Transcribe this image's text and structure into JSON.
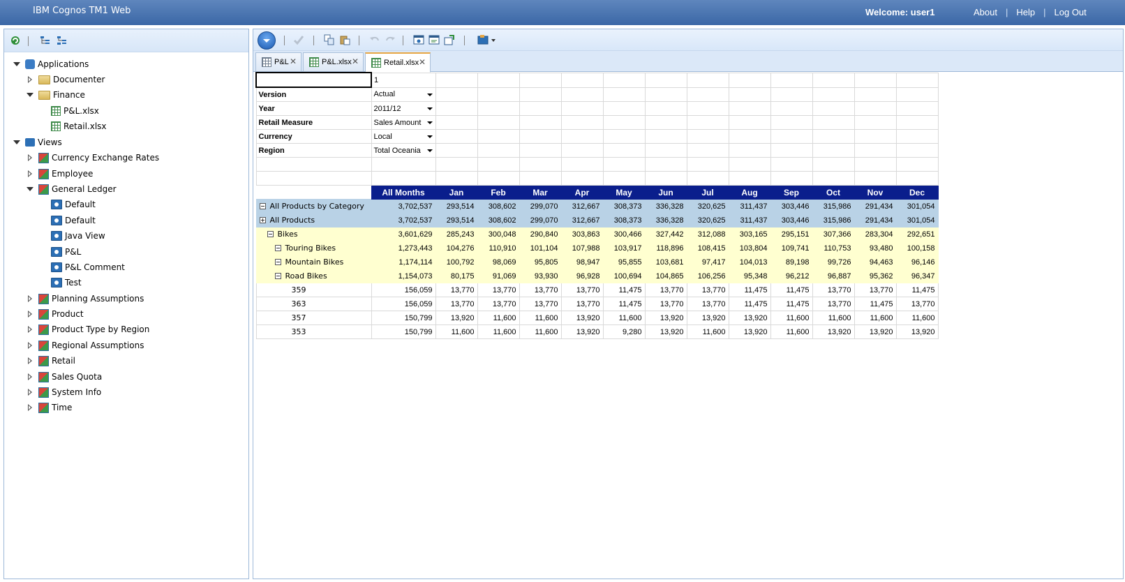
{
  "header": {
    "app_title": "IBM Cognos TM1 Web",
    "welcome": "Welcome: user1",
    "links": [
      "About",
      "Help",
      "Log Out"
    ]
  },
  "tree": {
    "items": [
      {
        "label": "Applications",
        "icon": "applications-icon",
        "level": 0,
        "state": "expanded"
      },
      {
        "label": "Documenter",
        "icon": "folder-icon",
        "level": 1,
        "state": "collapsed"
      },
      {
        "label": "Finance",
        "icon": "folder-icon",
        "level": 1,
        "state": "expanded"
      },
      {
        "label": "P&L.xlsx",
        "icon": "spreadsheet-icon",
        "level": 2,
        "state": "leaf"
      },
      {
        "label": "Retail.xlsx",
        "icon": "spreadsheet-icon",
        "level": 2,
        "state": "leaf"
      },
      {
        "label": "Views",
        "icon": "views-icon",
        "level": 0,
        "state": "expanded"
      },
      {
        "label": "Currency Exchange Rates",
        "icon": "cube-icon",
        "level": 1,
        "state": "collapsed"
      },
      {
        "label": "Employee",
        "icon": "cube-icon",
        "level": 1,
        "state": "collapsed"
      },
      {
        "label": "General Ledger",
        "icon": "cube-icon",
        "level": 1,
        "state": "expanded"
      },
      {
        "label": "Default",
        "icon": "view-icon",
        "level": 2,
        "state": "leaf"
      },
      {
        "label": "Default",
        "icon": "view-icon",
        "level": 2,
        "state": "leaf"
      },
      {
        "label": "Java View",
        "icon": "view-icon",
        "level": 2,
        "state": "leaf"
      },
      {
        "label": "P&L",
        "icon": "view-icon",
        "level": 2,
        "state": "leaf"
      },
      {
        "label": "P&L Comment",
        "icon": "view-icon",
        "level": 2,
        "state": "leaf"
      },
      {
        "label": "Test",
        "icon": "view-icon",
        "level": 2,
        "state": "leaf"
      },
      {
        "label": "Planning Assumptions",
        "icon": "cube-icon",
        "level": 1,
        "state": "collapsed"
      },
      {
        "label": "Product",
        "icon": "cube-icon",
        "level": 1,
        "state": "collapsed"
      },
      {
        "label": "Product Type by Region",
        "icon": "cube-icon",
        "level": 1,
        "state": "collapsed"
      },
      {
        "label": "Regional Assumptions",
        "icon": "cube-icon",
        "level": 1,
        "state": "collapsed"
      },
      {
        "label": "Retail",
        "icon": "cube-icon",
        "level": 1,
        "state": "collapsed"
      },
      {
        "label": "Sales Quota",
        "icon": "cube-icon",
        "level": 1,
        "state": "collapsed"
      },
      {
        "label": "System Info",
        "icon": "cube-icon",
        "level": 1,
        "state": "collapsed"
      },
      {
        "label": "Time",
        "icon": "cube-icon",
        "level": 1,
        "state": "collapsed"
      }
    ]
  },
  "tabs": [
    {
      "label": "P&L",
      "icon": "cube-view-icon",
      "active": false
    },
    {
      "label": "P&L.xlsx",
      "icon": "spreadsheet-icon",
      "active": false
    },
    {
      "label": "Retail.xlsx",
      "icon": "spreadsheet-icon",
      "active": true
    }
  ],
  "sheet": {
    "selected_cell_value": "",
    "cell_b1": "1",
    "params": [
      {
        "label": "Version",
        "value": "Actual"
      },
      {
        "label": "Year",
        "value": "2011/12"
      },
      {
        "label": "Retail Measure",
        "value": "Sales Amount"
      },
      {
        "label": "Currency",
        "value": "Local"
      },
      {
        "label": "Region",
        "value": "Total Oceania"
      }
    ],
    "columns": [
      "All Months",
      "Jan",
      "Feb",
      "Mar",
      "Apr",
      "May",
      "Jun",
      "Jul",
      "Aug",
      "Sep",
      "Oct",
      "Nov",
      "Dec"
    ],
    "rows": [
      {
        "label": "All Products by Category",
        "style": "blue",
        "indent": 0,
        "toggle": "minus",
        "values": [
          "3,702,537",
          "293,514",
          "308,602",
          "299,070",
          "312,667",
          "308,373",
          "336,328",
          "320,625",
          "311,437",
          "303,446",
          "315,986",
          "291,434",
          "301,054"
        ]
      },
      {
        "label": "All Products",
        "style": "blue",
        "indent": 0,
        "toggle": "plus",
        "values": [
          "3,702,537",
          "293,514",
          "308,602",
          "299,070",
          "312,667",
          "308,373",
          "336,328",
          "320,625",
          "311,437",
          "303,446",
          "315,986",
          "291,434",
          "301,054"
        ]
      },
      {
        "label": "Bikes",
        "style": "yellow",
        "indent": 1,
        "toggle": "minus",
        "values": [
          "3,601,629",
          "285,243",
          "300,048",
          "290,840",
          "303,863",
          "300,466",
          "327,442",
          "312,088",
          "303,165",
          "295,151",
          "307,366",
          "283,304",
          "292,651"
        ]
      },
      {
        "label": "Touring Bikes",
        "style": "yellow",
        "indent": 2,
        "toggle": "minus",
        "values": [
          "1,273,443",
          "104,276",
          "110,910",
          "101,104",
          "107,988",
          "103,917",
          "118,896",
          "108,415",
          "103,804",
          "109,741",
          "110,753",
          "93,480",
          "100,158"
        ]
      },
      {
        "label": "Mountain Bikes",
        "style": "yellow",
        "indent": 2,
        "toggle": "minus",
        "values": [
          "1,174,114",
          "100,792",
          "98,069",
          "95,805",
          "98,947",
          "95,855",
          "103,681",
          "97,417",
          "104,013",
          "89,198",
          "99,726",
          "94,463",
          "96,146"
        ]
      },
      {
        "label": "Road Bikes",
        "style": "yellow",
        "indent": 2,
        "toggle": "minus",
        "values": [
          "1,154,073",
          "80,175",
          "91,069",
          "93,930",
          "96,928",
          "100,694",
          "104,865",
          "106,256",
          "95,348",
          "96,212",
          "96,887",
          "95,362",
          "96,347"
        ]
      },
      {
        "label": "359",
        "style": "plain",
        "indent": 3,
        "toggle": "none",
        "values": [
          "156,059",
          "13,770",
          "13,770",
          "13,770",
          "13,770",
          "11,475",
          "13,770",
          "13,770",
          "11,475",
          "11,475",
          "13,770",
          "13,770",
          "11,475"
        ]
      },
      {
        "label": "363",
        "style": "plain",
        "indent": 3,
        "toggle": "none",
        "values": [
          "156,059",
          "13,770",
          "13,770",
          "13,770",
          "13,770",
          "11,475",
          "13,770",
          "13,770",
          "11,475",
          "11,475",
          "13,770",
          "11,475",
          "13,770"
        ]
      },
      {
        "label": "357",
        "style": "plain",
        "indent": 3,
        "toggle": "none",
        "values": [
          "150,799",
          "13,920",
          "11,600",
          "11,600",
          "13,920",
          "11,600",
          "13,920",
          "13,920",
          "13,920",
          "11,600",
          "11,600",
          "11,600",
          "11,600"
        ]
      },
      {
        "label": "353",
        "style": "plain",
        "indent": 3,
        "toggle": "none",
        "values": [
          "150,799",
          "11,600",
          "11,600",
          "11,600",
          "13,920",
          "9,280",
          "13,920",
          "11,600",
          "13,920",
          "11,600",
          "13,920",
          "13,920",
          "13,920"
        ]
      }
    ]
  },
  "colors": {
    "header_bar": "#3b67a6",
    "column_header": "#0a1e8c",
    "row_blue": "#b9d2e6",
    "row_yellow": "#ffffd0",
    "active_tab_accent": "#e7a643"
  }
}
